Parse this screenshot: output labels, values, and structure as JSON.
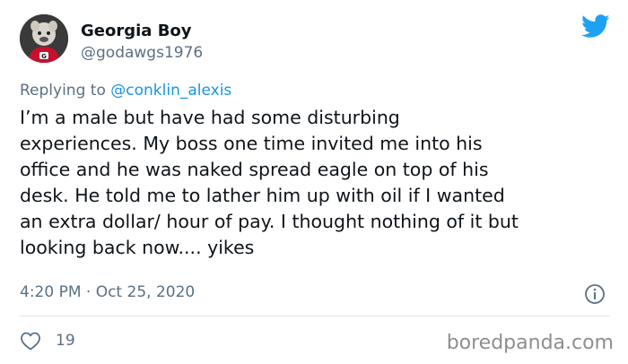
{
  "author": {
    "display_name": "Georgia Boy",
    "handle": "@godawgs1976",
    "avatar_icon": "bulldog-avatar"
  },
  "brand": {
    "icon": "twitter-bird-icon",
    "color": "#1da1f2"
  },
  "reply": {
    "prefix": "Replying to ",
    "mention": "@conklin_alexis",
    "mention_color": "#1b95e0"
  },
  "tweet": {
    "lines": [
      "I’m a male but have had some disturbing",
      "experiences. My boss one time invited me into his",
      "office and he was naked spread eagle on top of his",
      "desk. He told me to lather him up with oil if I wanted",
      "an extra dollar/ hour of pay. I thought nothing of it but",
      "looking back now.... yikes"
    ],
    "timestamp": "4:20 PM · Oct 25, 2020",
    "likes": "19"
  },
  "icons": {
    "info": "info-icon",
    "like": "heart-icon"
  },
  "watermark": "boredpanda.com"
}
